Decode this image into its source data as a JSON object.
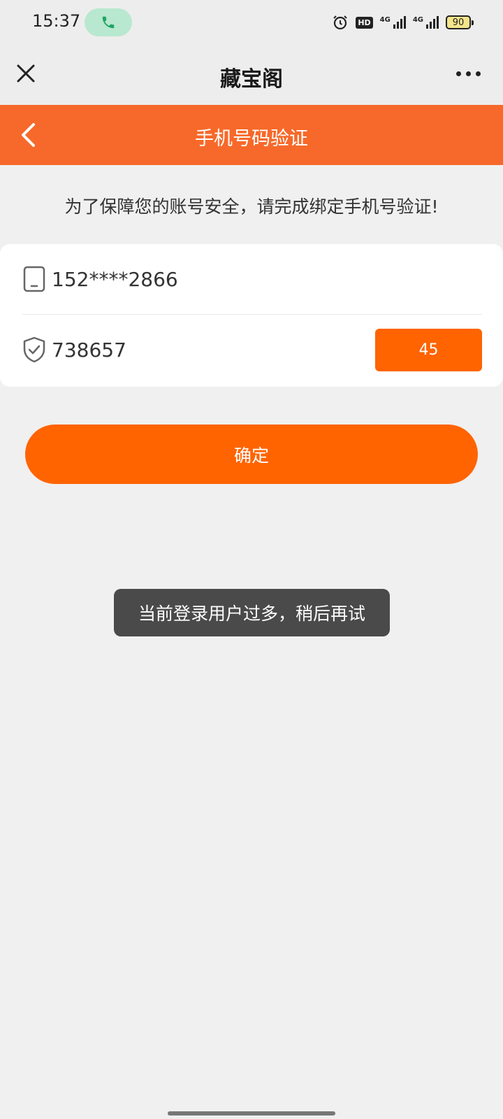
{
  "status_bar": {
    "time": "15:37",
    "icons": [
      "phone-call-icon",
      "alarm-icon",
      "hd-icon",
      "signal-4g-icon",
      "signal-4g-icon",
      "battery-icon"
    ],
    "hd_label": "HD",
    "network_label_1": "4G",
    "network_label_2": "4G",
    "battery_level": "90",
    "call_color": "#1fa463"
  },
  "wx_header": {
    "title": "藏宝阁",
    "icons": [
      "close-icon",
      "more-icon"
    ]
  },
  "nav": {
    "title": "手机号码验证",
    "color": "#f7692a",
    "icons": [
      "back-arrow-icon"
    ]
  },
  "notice": "为了保障您的账号安全，请完成绑定手机号验证!",
  "form": {
    "phone_value": "152****2866",
    "code_value": "738657",
    "countdown": "45",
    "icons": [
      "phone-icon",
      "shield-check-icon"
    ]
  },
  "confirm_label": "确定",
  "accent_color": "#ff6400",
  "toast": "当前登录用户过多，稍后再试"
}
